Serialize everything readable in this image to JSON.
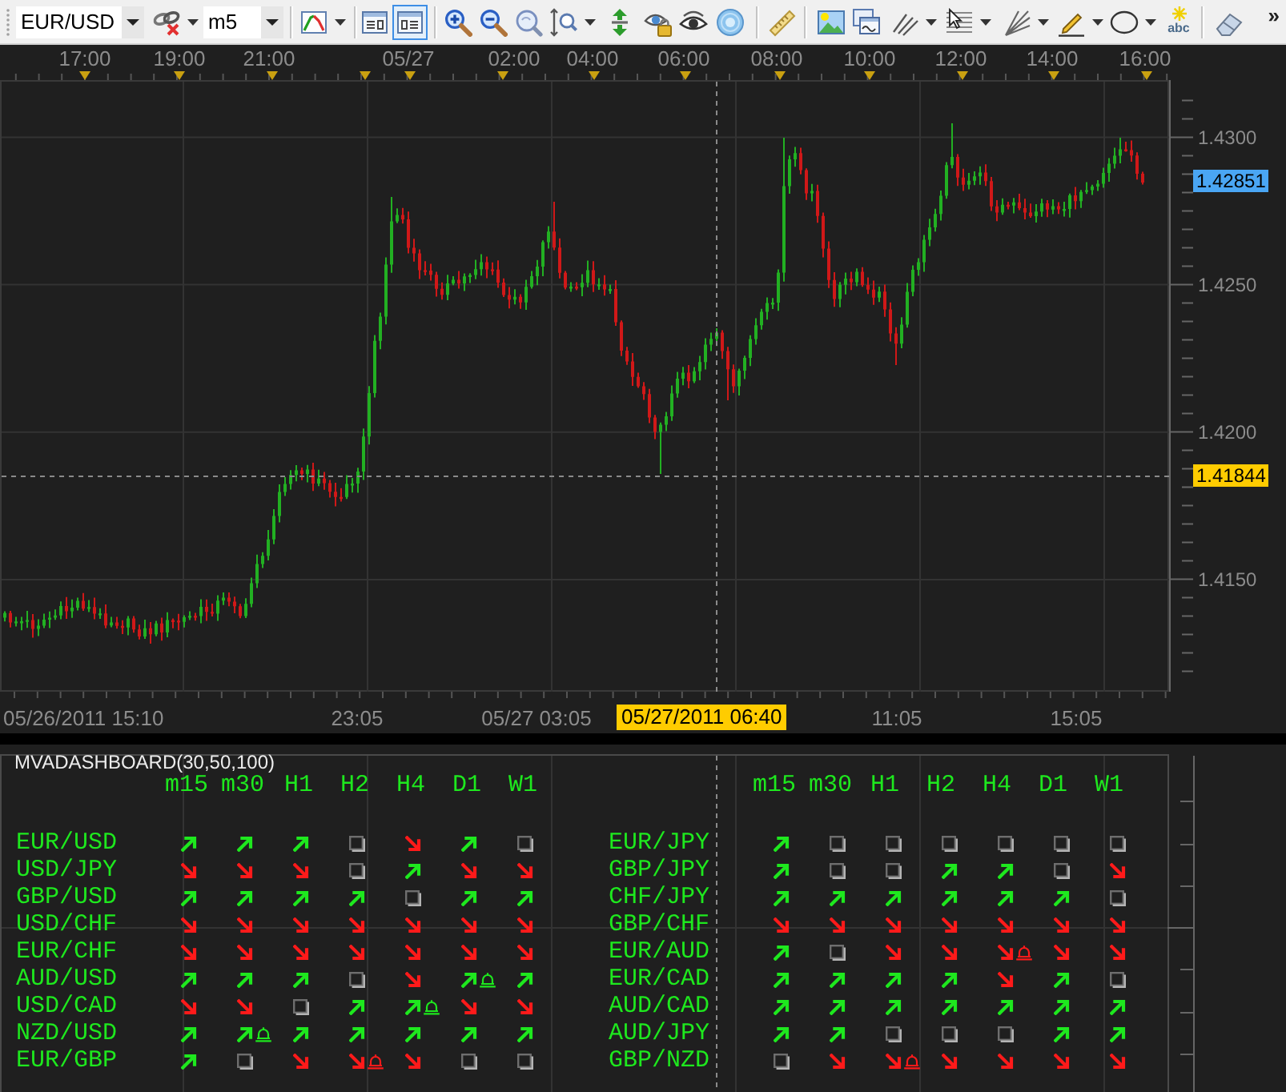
{
  "toolbar": {
    "symbol": {
      "value": "EUR/USD"
    },
    "timeframe": {
      "value": "m5"
    },
    "view_toggles": [
      {
        "selected": false
      },
      {
        "selected": true
      }
    ],
    "text_tool": "abc",
    "overflow": "»"
  },
  "chart": {
    "time_axis": [
      "17:00",
      "19:00",
      "21:00",
      "05/27",
      "02:00",
      "04:00",
      "06:00",
      "08:00",
      "10:00",
      "12:00",
      "14:00",
      "16:00"
    ],
    "price_axis": [
      "1.4300",
      "1.4250",
      "1.4200",
      "1.4150"
    ],
    "current_price": "1.42851",
    "cursor_price": "1.41844",
    "bottom_axis": [
      "05/26/2011 15:10",
      "23:05",
      "05/27 03:05",
      "11:05",
      "15:05"
    ],
    "cursor_time": "05/27/2011 06:40"
  },
  "indicator": {
    "title": "MVADASHBOARD(30,50,100)",
    "tables": [
      {
        "columns": [
          "m15",
          "m30",
          "H1",
          "H2",
          "H4",
          "D1",
          "W1"
        ],
        "rows": [
          {
            "pair": "EUR/USD",
            "cells": [
              {
                "kind": "up",
                "alert": false
              },
              {
                "kind": "up",
                "alert": false
              },
              {
                "kind": "up",
                "alert": false
              },
              {
                "kind": "flat",
                "alert": false
              },
              {
                "kind": "down",
                "alert": false
              },
              {
                "kind": "up",
                "alert": false
              },
              {
                "kind": "flat",
                "alert": false
              }
            ]
          },
          {
            "pair": "USD/JPY",
            "cells": [
              {
                "kind": "down",
                "alert": false
              },
              {
                "kind": "down",
                "alert": false
              },
              {
                "kind": "down",
                "alert": false
              },
              {
                "kind": "flat",
                "alert": false
              },
              {
                "kind": "up",
                "alert": false
              },
              {
                "kind": "down",
                "alert": false
              },
              {
                "kind": "down",
                "alert": false
              }
            ]
          },
          {
            "pair": "GBP/USD",
            "cells": [
              {
                "kind": "up",
                "alert": false
              },
              {
                "kind": "up",
                "alert": false
              },
              {
                "kind": "up",
                "alert": false
              },
              {
                "kind": "up",
                "alert": false
              },
              {
                "kind": "flat",
                "alert": false
              },
              {
                "kind": "up",
                "alert": false
              },
              {
                "kind": "up",
                "alert": false
              }
            ]
          },
          {
            "pair": "USD/CHF",
            "cells": [
              {
                "kind": "down",
                "alert": false
              },
              {
                "kind": "down",
                "alert": false
              },
              {
                "kind": "down",
                "alert": false
              },
              {
                "kind": "down",
                "alert": false
              },
              {
                "kind": "down",
                "alert": false
              },
              {
                "kind": "down",
                "alert": false
              },
              {
                "kind": "down",
                "alert": false
              }
            ]
          },
          {
            "pair": "EUR/CHF",
            "cells": [
              {
                "kind": "down",
                "alert": false
              },
              {
                "kind": "down",
                "alert": false
              },
              {
                "kind": "down",
                "alert": false
              },
              {
                "kind": "down",
                "alert": false
              },
              {
                "kind": "down",
                "alert": false
              },
              {
                "kind": "down",
                "alert": false
              },
              {
                "kind": "down",
                "alert": false
              }
            ]
          },
          {
            "pair": "AUD/USD",
            "cells": [
              {
                "kind": "up",
                "alert": false
              },
              {
                "kind": "up",
                "alert": false
              },
              {
                "kind": "up",
                "alert": false
              },
              {
                "kind": "flat",
                "alert": false
              },
              {
                "kind": "down",
                "alert": false
              },
              {
                "kind": "up",
                "alert": true
              },
              {
                "kind": "up",
                "alert": false
              }
            ]
          },
          {
            "pair": "USD/CAD",
            "cells": [
              {
                "kind": "down",
                "alert": false
              },
              {
                "kind": "down",
                "alert": false
              },
              {
                "kind": "flat",
                "alert": false
              },
              {
                "kind": "up",
                "alert": false
              },
              {
                "kind": "up",
                "alert": true
              },
              {
                "kind": "down",
                "alert": false
              },
              {
                "kind": "down",
                "alert": false
              }
            ]
          },
          {
            "pair": "NZD/USD",
            "cells": [
              {
                "kind": "up",
                "alert": false
              },
              {
                "kind": "up",
                "alert": true
              },
              {
                "kind": "up",
                "alert": false
              },
              {
                "kind": "up",
                "alert": false
              },
              {
                "kind": "up",
                "alert": false
              },
              {
                "kind": "up",
                "alert": false
              },
              {
                "kind": "up",
                "alert": false
              }
            ]
          },
          {
            "pair": "EUR/GBP",
            "cells": [
              {
                "kind": "up",
                "alert": false
              },
              {
                "kind": "flat",
                "alert": false
              },
              {
                "kind": "down",
                "alert": false
              },
              {
                "kind": "down",
                "alert": true
              },
              {
                "kind": "down",
                "alert": false
              },
              {
                "kind": "flat",
                "alert": false
              },
              {
                "kind": "flat",
                "alert": false
              }
            ]
          }
        ]
      },
      {
        "columns": [
          "m15",
          "m30",
          "H1",
          "H2",
          "H4",
          "D1",
          "W1"
        ],
        "rows": [
          {
            "pair": "EUR/JPY",
            "cells": [
              {
                "kind": "up",
                "alert": false
              },
              {
                "kind": "flat",
                "alert": false
              },
              {
                "kind": "flat",
                "alert": false
              },
              {
                "kind": "flat",
                "alert": false
              },
              {
                "kind": "flat",
                "alert": false
              },
              {
                "kind": "flat",
                "alert": false
              },
              {
                "kind": "flat",
                "alert": false
              }
            ]
          },
          {
            "pair": "GBP/JPY",
            "cells": [
              {
                "kind": "up",
                "alert": false
              },
              {
                "kind": "flat",
                "alert": false
              },
              {
                "kind": "flat",
                "alert": false
              },
              {
                "kind": "up",
                "alert": false
              },
              {
                "kind": "up",
                "alert": false
              },
              {
                "kind": "flat",
                "alert": false
              },
              {
                "kind": "down",
                "alert": false
              }
            ]
          },
          {
            "pair": "CHF/JPY",
            "cells": [
              {
                "kind": "up",
                "alert": false
              },
              {
                "kind": "up",
                "alert": false
              },
              {
                "kind": "up",
                "alert": false
              },
              {
                "kind": "up",
                "alert": false
              },
              {
                "kind": "up",
                "alert": false
              },
              {
                "kind": "up",
                "alert": false
              },
              {
                "kind": "flat",
                "alert": false
              }
            ]
          },
          {
            "pair": "GBP/CHF",
            "cells": [
              {
                "kind": "down",
                "alert": false
              },
              {
                "kind": "down",
                "alert": false
              },
              {
                "kind": "down",
                "alert": false
              },
              {
                "kind": "down",
                "alert": false
              },
              {
                "kind": "down",
                "alert": false
              },
              {
                "kind": "down",
                "alert": false
              },
              {
                "kind": "down",
                "alert": false
              }
            ]
          },
          {
            "pair": "EUR/AUD",
            "cells": [
              {
                "kind": "up",
                "alert": false
              },
              {
                "kind": "flat",
                "alert": false
              },
              {
                "kind": "down",
                "alert": false
              },
              {
                "kind": "down",
                "alert": false
              },
              {
                "kind": "down",
                "alert": true
              },
              {
                "kind": "down",
                "alert": false
              },
              {
                "kind": "down",
                "alert": false
              }
            ]
          },
          {
            "pair": "EUR/CAD",
            "cells": [
              {
                "kind": "up",
                "alert": false
              },
              {
                "kind": "up",
                "alert": false
              },
              {
                "kind": "up",
                "alert": false
              },
              {
                "kind": "up",
                "alert": false
              },
              {
                "kind": "down",
                "alert": false
              },
              {
                "kind": "up",
                "alert": false
              },
              {
                "kind": "flat",
                "alert": false
              }
            ]
          },
          {
            "pair": "AUD/CAD",
            "cells": [
              {
                "kind": "up",
                "alert": false
              },
              {
                "kind": "up",
                "alert": false
              },
              {
                "kind": "up",
                "alert": false
              },
              {
                "kind": "up",
                "alert": false
              },
              {
                "kind": "up",
                "alert": false
              },
              {
                "kind": "up",
                "alert": false
              },
              {
                "kind": "up",
                "alert": false
              }
            ]
          },
          {
            "pair": "AUD/JPY",
            "cells": [
              {
                "kind": "up",
                "alert": false
              },
              {
                "kind": "up",
                "alert": false
              },
              {
                "kind": "flat",
                "alert": false
              },
              {
                "kind": "flat",
                "alert": false
              },
              {
                "kind": "flat",
                "alert": false
              },
              {
                "kind": "up",
                "alert": false
              },
              {
                "kind": "up",
                "alert": false
              }
            ]
          },
          {
            "pair": "GBP/NZD",
            "cells": [
              {
                "kind": "flat",
                "alert": false
              },
              {
                "kind": "down",
                "alert": false
              },
              {
                "kind": "down",
                "alert": true
              },
              {
                "kind": "down",
                "alert": false
              },
              {
                "kind": "down",
                "alert": false
              },
              {
                "kind": "down",
                "alert": false
              },
              {
                "kind": "down",
                "alert": false
              }
            ]
          }
        ]
      }
    ]
  }
}
